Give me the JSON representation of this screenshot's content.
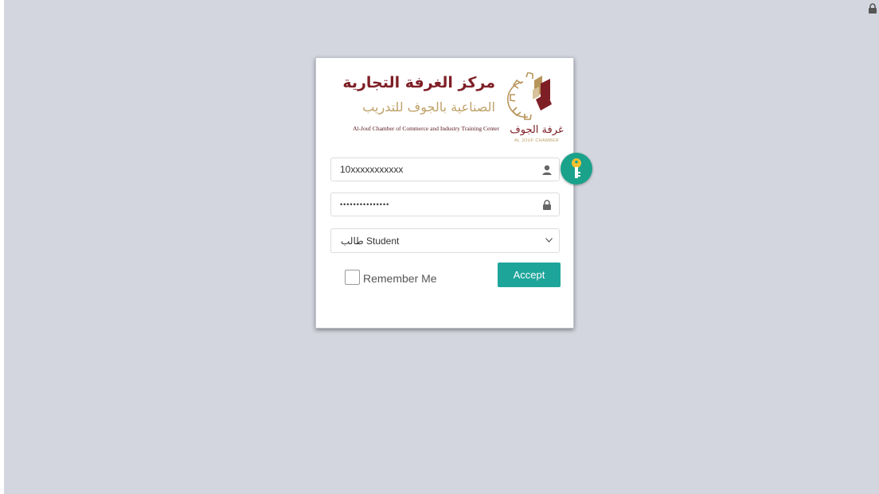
{
  "brand": {
    "title_ar": "مركز الغرفة التجارية",
    "subtitle_ar": "الصناعية بالجوف للتدريب",
    "subtitle_en": "Al-Jouf Chamber of Commerce and Industry Training Center",
    "logo_ar": "غرفة الجوف",
    "logo_en": "AL JOUF CHAMBER"
  },
  "form": {
    "username_value": "10xxxxxxxxxxx",
    "password_value": "•••••••••••••••",
    "user_type_selected": "طالب Student",
    "remember_label": "Remember Me",
    "remember_checked": false,
    "accept_label": "Accept"
  },
  "icons": {
    "top_right": "lock-icon",
    "username": "user-icon",
    "password": "lock-icon",
    "select": "chevron-down-icon",
    "badge": "key-icon"
  },
  "colors": {
    "background": "#d3d6df",
    "accent": "#1ea59a",
    "brand_maroon": "#7e1f26",
    "brand_gold": "#bfa26a"
  }
}
